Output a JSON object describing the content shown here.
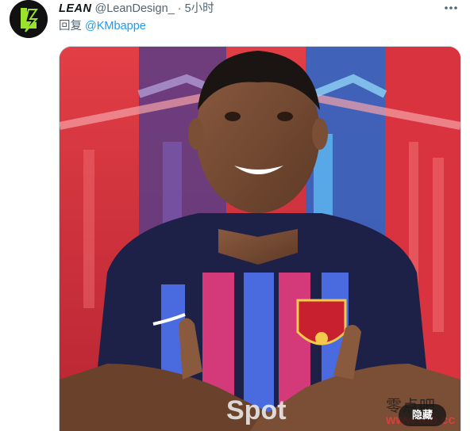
{
  "tweet": {
    "display_name": "LEAN",
    "handle": "@LeanDesign_",
    "separator": "·",
    "time": "5小时",
    "reply_label": "回复",
    "reply_to": "@KMbappe",
    "hide_button": "隐藏",
    "avatar_logo": "lean-logo",
    "watermark_cn": "零点吧",
    "watermark_url": "www.ldb.cc"
  },
  "icons": {
    "more": "more-dots-icon"
  },
  "colors": {
    "link": "#1d9bf0",
    "secondary_text": "#536471",
    "avatar_green": "#9be22d"
  }
}
